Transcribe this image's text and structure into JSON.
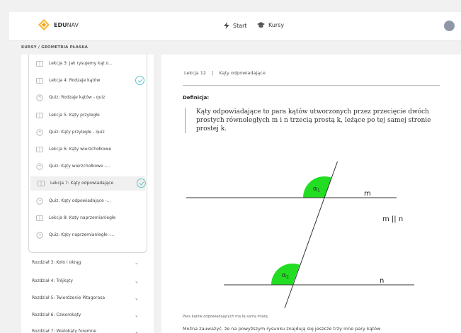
{
  "header": {
    "brand_bold": "EDU",
    "brand_rest": "NAV",
    "nav_start": "Start",
    "nav_kursy": "Kursy"
  },
  "breadcrumb": "KURSY / GEOMETRIA PŁASKA",
  "sidebar": {
    "lessons": [
      {
        "type": "lesson",
        "label": "Lekcja 3:  Jak rysujemy kąt o...",
        "done": false,
        "active": false
      },
      {
        "type": "lesson",
        "label": "Lekcja 4:  Rodzaje kątów",
        "done": true,
        "active": false
      },
      {
        "type": "quiz",
        "label": "Quiz:  Rodzaje kątów - quiz",
        "done": false,
        "active": false
      },
      {
        "type": "lesson",
        "label": "Lekcja 5:  Kąty przyległe",
        "done": false,
        "active": false
      },
      {
        "type": "quiz",
        "label": "Quiz:  Kąty przyległe - quiz",
        "done": false,
        "active": false
      },
      {
        "type": "lesson",
        "label": "Lekcja 6:  Kąty wierzchołkowe",
        "done": false,
        "active": false
      },
      {
        "type": "quiz",
        "label": "Quiz:  Kąty wierzchołkowe -...",
        "done": false,
        "active": false
      },
      {
        "type": "lesson",
        "label": "Lekcja 7:  Kąty odpowiadające",
        "done": true,
        "active": true
      },
      {
        "type": "quiz",
        "label": "Quiz:  Kąty odpowiadające -...",
        "done": false,
        "active": false
      },
      {
        "type": "lesson",
        "label": "Lekcja 8:  Kąty naprzemianległe",
        "done": false,
        "active": false
      },
      {
        "type": "quiz",
        "label": "Quiz:  Kąty naprzemianległe -...",
        "done": false,
        "active": false
      }
    ],
    "chapters": [
      "Rozdział 3: Koło i okrąg",
      "Rozdział 4: Trójkąty",
      "Rozdział 5: Twierdzenie Pitagorasa",
      "Rozdział 6: Czworokąty",
      "Rozdział 7: Wielokąty foremne"
    ]
  },
  "content": {
    "lesson_number": "Lekcja 12",
    "separator": "|",
    "lesson_title": "Kąty odpowiadające",
    "definition_heading": "Definicja:",
    "definition_text": "Kąty odpowiadające to para kątów utworzonych przez przecięcie dwóch prostych równoległych m i n trzecią prostą k, leżące po tej samej stronie prostej k.",
    "diagram": {
      "label_m": "m",
      "label_n": "n",
      "label_parallel": "m || n",
      "alpha1": "α",
      "alpha1_sub": "1",
      "alpha2": "α",
      "alpha2_sub": "2",
      "angle_color": "#22dd22"
    },
    "caption": "Para kątów odpowiadających ma tę samą miarę.",
    "paragraph": "Można zauważyć, że na powyższym rysunku znajdują się jeszcze trzy inne pary kątów"
  }
}
